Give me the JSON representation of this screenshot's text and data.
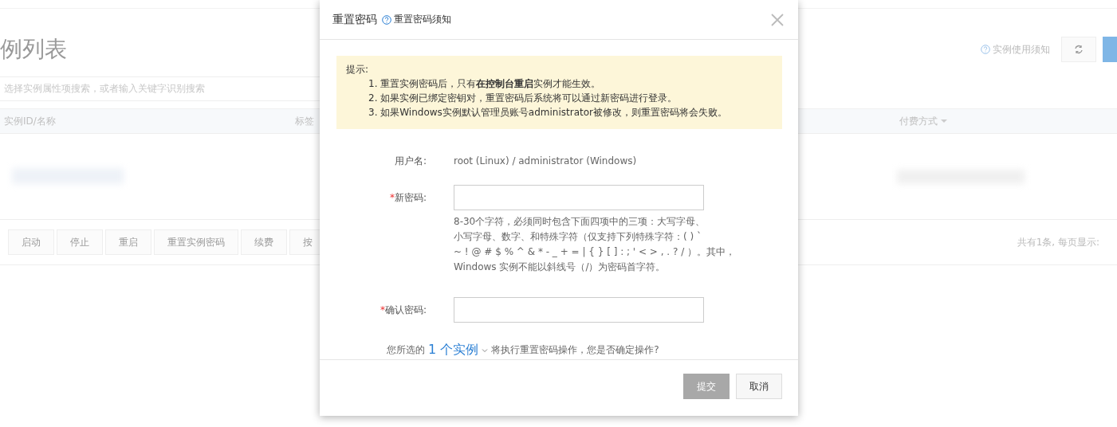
{
  "page": {
    "title": "例列表",
    "help_link": "实例使用须知",
    "search": {
      "placeholder": "选择实例属性项搜索，或者输入关键字识别搜索"
    },
    "table": {
      "columns": [
        {
          "label": "实例ID/名称",
          "sortable": false
        },
        {
          "label": "标签",
          "sortable": false
        },
        {
          "label": "付费方式",
          "sortable": true
        }
      ]
    },
    "actions": [
      {
        "label": "启动",
        "disabled": true
      },
      {
        "label": "停止",
        "disabled": true
      },
      {
        "label": "重启",
        "disabled": true
      },
      {
        "label": "重置实例密码",
        "disabled": true
      },
      {
        "label": "续费",
        "disabled": true
      },
      {
        "label": "按",
        "disabled": true
      }
    ],
    "pagination": "共有1条, 每页显示:"
  },
  "dialog": {
    "title": "重置密码",
    "help_link": "重置密码须知",
    "notice": {
      "heading": "提示:",
      "items": [
        "1. 重置实例密码后，只有**在控制台重启**实例才能生效。",
        "2. 如果实例已绑定密钥对，重置密码后系统将可以通过新密码进行登录。",
        "3. 如果Windows实例默认管理员账号administrator被修改，则重置密码将会失败。"
      ]
    },
    "fields": [
      {
        "kind": "text",
        "label": "用户名:",
        "value": "root (Linux) / administrator (Windows)"
      },
      {
        "kind": "password",
        "label": "新密码:",
        "required_mark": "*",
        "hint": [
          "8-30个字符，必须同时包含下面四项中的三项：大写字母、",
          "小写字母、数字、和特殊字符（仅支持下列特殊字符：( ) `",
          "~ ! @ # $ % ^ & * - _ + = | { } [ ] : ; ' < > , . ? / ）。其中，",
          "Windows 实例不能以斜线号（/）为密码首字符。"
        ]
      },
      {
        "kind": "password",
        "label": "确认密码:",
        "required_mark": "*"
      }
    ],
    "confirm": {
      "before": "您所选的",
      "link": "1 个实例",
      "after": "将执行重置密码操作，您是否确定操作?"
    },
    "buttons": [
      {
        "label": "提交",
        "kind": "primary",
        "disabled": true
      },
      {
        "label": "取消",
        "kind": "secondary",
        "disabled": false
      }
    ]
  }
}
